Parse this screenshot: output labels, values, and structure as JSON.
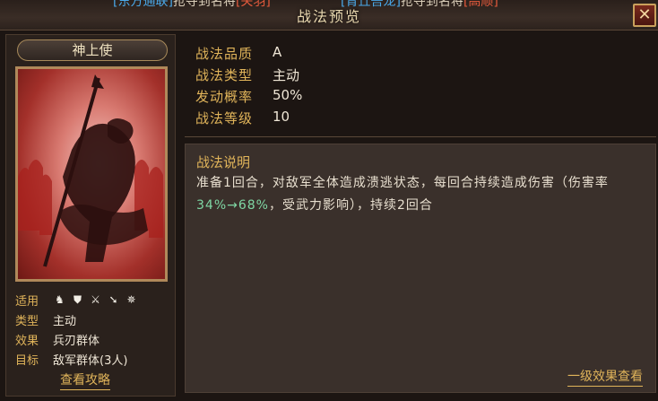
{
  "dialog": {
    "title": "战法预览",
    "close_label": "✕"
  },
  "top_cut": {
    "left": {
      "tag": "[东方通联]",
      "text": "抢夺到名将",
      "name": "[关羽]"
    },
    "right": {
      "tag": "[青丘吾龙]",
      "text": "抢夺到名将",
      "name": "[高顺]"
    }
  },
  "card": {
    "name": "神上使"
  },
  "left_stats": {
    "applicable_label": "适用",
    "applicable_icons": [
      "cavalry-icon",
      "shield-icon",
      "crossed-swords-icon",
      "spear-icon",
      "siege-icon"
    ],
    "type_label": "类型",
    "type_value": "主动",
    "effect_label": "效果",
    "effect_value": "兵刃群体",
    "target_label": "目标",
    "target_value": "敌军群体(3人)",
    "guide_link": "查看攻略"
  },
  "info": {
    "quality_label": "战法品质",
    "quality_value": "A",
    "type_label": "战法类型",
    "type_value": "主动",
    "rate_label": "发动概率",
    "rate_value": "50%",
    "level_label": "战法等级",
    "level_value": "10"
  },
  "description": {
    "title": "战法说明",
    "part1": "准备1回合，对敌军全体造成溃逃状态，每回合持续造成伤害（伤害率",
    "range": "34%→68%",
    "part2": "，受武力影响），持续2回合",
    "detail_link": "一级效果查看"
  },
  "colors": {
    "accent_gold": "#e0b45a",
    "growth_green": "#7fd7a4"
  }
}
